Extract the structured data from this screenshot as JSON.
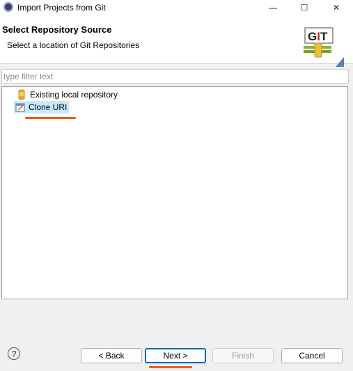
{
  "window": {
    "title": "Import Projects from Git",
    "controls": {
      "minimize": "—",
      "maximize": "☐",
      "close": "✕"
    }
  },
  "header": {
    "title": "Select Repository Source",
    "subtitle": "Select a location of Git Repositories",
    "logo_text": "GIT"
  },
  "filter": {
    "placeholder": "type filter text",
    "value": ""
  },
  "tree": {
    "items": [
      {
        "label": "Existing local repository",
        "icon": "repository-icon",
        "selected": false
      },
      {
        "label": "Clone URI",
        "icon": "clone-uri-icon",
        "selected": true
      }
    ]
  },
  "buttons": {
    "help": "?",
    "back": "< Back",
    "next": "Next >",
    "finish": "Finish",
    "cancel": "Cancel"
  },
  "colors": {
    "annotation": "#f25a16",
    "selection": "#cce8ff",
    "default_button_border": "#0067c0"
  }
}
